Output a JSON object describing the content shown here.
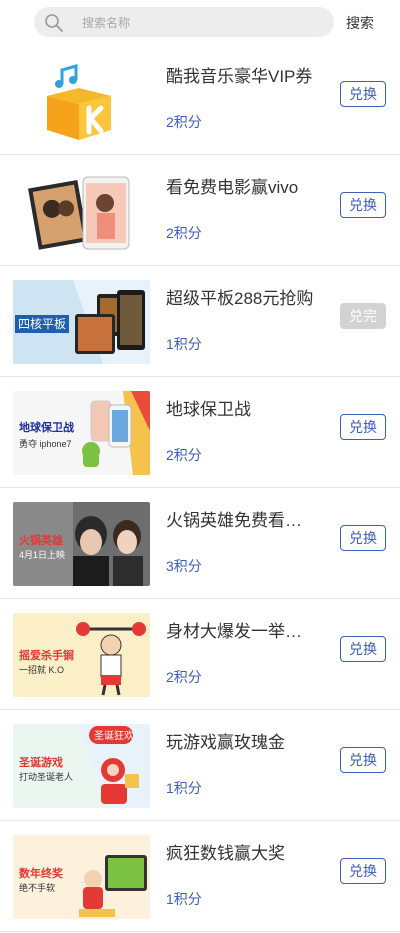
{
  "search": {
    "placeholder": "搜索名称",
    "button_label": "搜索"
  },
  "items": [
    {
      "title": "酷我音乐豪华VIP券",
      "points": "2积分",
      "button": "兑换",
      "disabled": false
    },
    {
      "title": "看免费电影赢vivo",
      "points": "2积分",
      "button": "兑换",
      "disabled": false
    },
    {
      "title": "超级平板288元抢购",
      "points": "1积分",
      "button": "兑完",
      "disabled": true,
      "banner_text": "四核平板"
    },
    {
      "title": "地球保卫战",
      "points": "2积分",
      "button": "兑换",
      "disabled": false,
      "banner_text": "地球保卫战",
      "banner_sub": "勇夺 iphone7"
    },
    {
      "title": "火锅英雄免费看…",
      "points": "3积分",
      "button": "兑换",
      "disabled": false,
      "banner_text": "火锅英雄",
      "banner_sub": "4月1日上映"
    },
    {
      "title": "身材大爆发一举…",
      "points": "2积分",
      "button": "兑换",
      "disabled": false,
      "banner_text": "摇爱杀手锏",
      "banner_sub": "一招就 K.O"
    },
    {
      "title": "玩游戏赢玫瑰金",
      "points": "1积分",
      "button": "兑换",
      "disabled": false,
      "banner_text": "圣诞游戏",
      "banner_sub": "打动圣诞老人",
      "banner_tag": "圣诞狂欢"
    },
    {
      "title": "疯狂数钱赢大奖",
      "points": "1积分",
      "button": "兑换",
      "disabled": false,
      "banner_text": "数年终奖",
      "banner_sub": "绝不手软"
    }
  ],
  "colors": {
    "accent": "#3e5fb6",
    "disabled": "#d2d2d2",
    "divider": "#e6e6e6"
  }
}
